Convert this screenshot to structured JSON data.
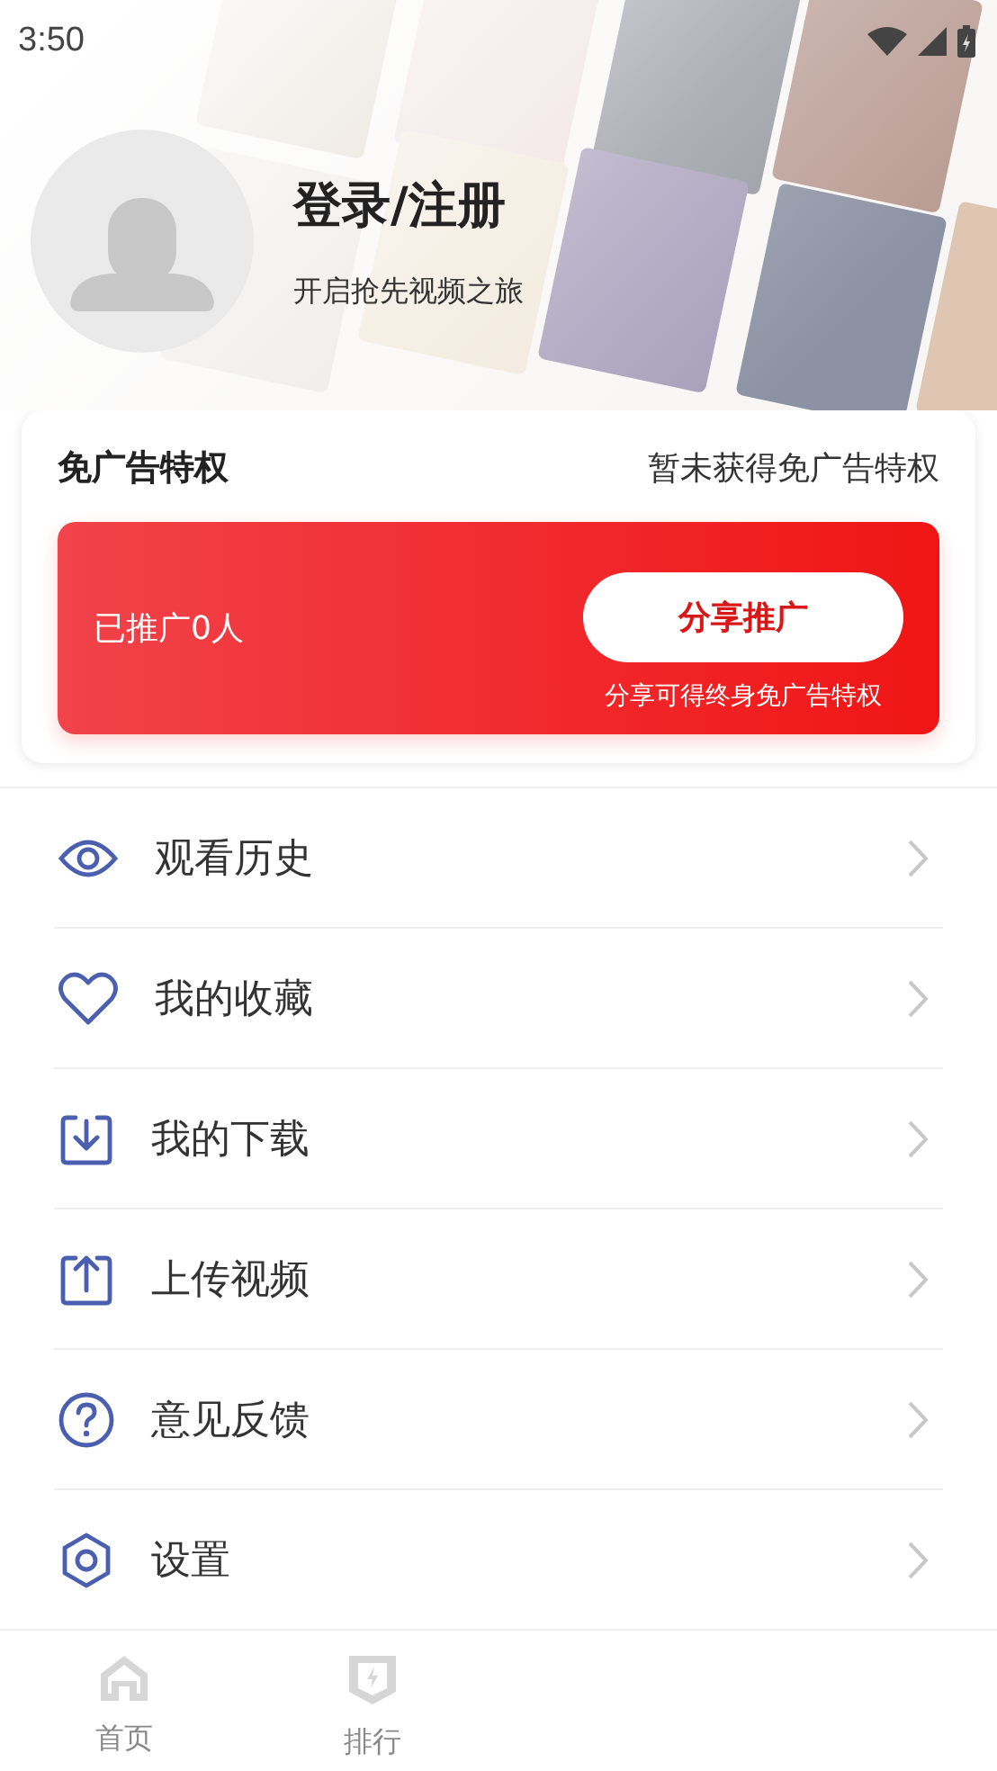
{
  "status_bar": {
    "time": "3:50"
  },
  "profile": {
    "title": "登录/注册",
    "subtitle": "开启抢先视频之旅"
  },
  "ad_free": {
    "title": "免广告特权",
    "status": "暂未获得免广告特权",
    "promoted": "已推广0人",
    "button": "分享推广",
    "note": "分享可得终身免广告特权"
  },
  "menu": [
    {
      "kind": "history",
      "label": "观看历史"
    },
    {
      "kind": "favorite",
      "label": "我的收藏"
    },
    {
      "kind": "download",
      "label": "我的下载"
    },
    {
      "kind": "upload",
      "label": "上传视频"
    },
    {
      "kind": "feedback",
      "label": "意见反馈"
    },
    {
      "kind": "settings",
      "label": "设置"
    }
  ],
  "tabs": [
    {
      "kind": "home",
      "label": "首页",
      "selected": false
    },
    {
      "kind": "rank",
      "label": "排行",
      "selected": false
    }
  ]
}
